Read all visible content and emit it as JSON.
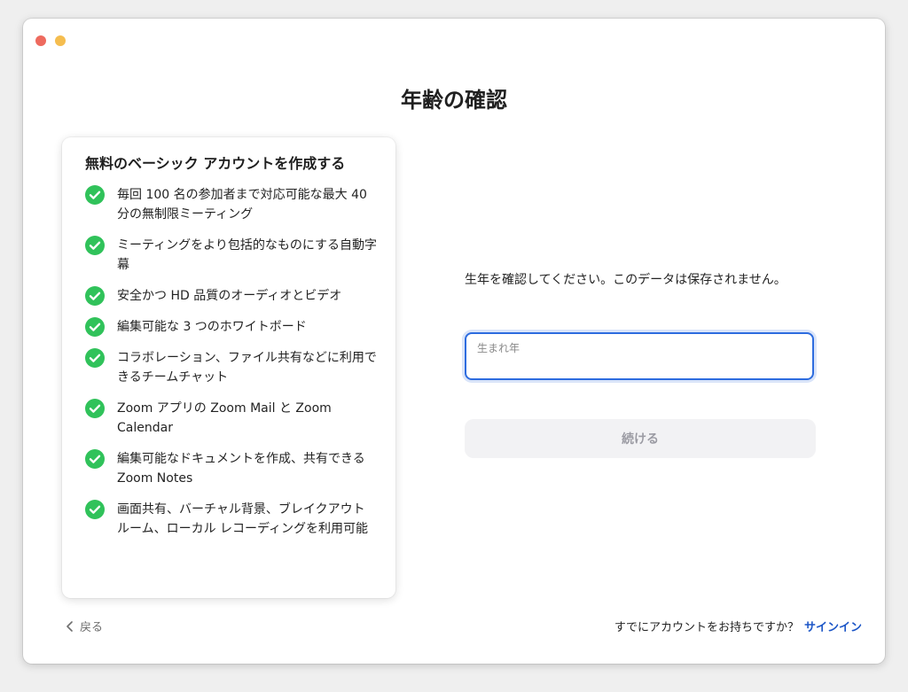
{
  "window": {
    "controls": [
      "close",
      "minimize"
    ]
  },
  "page": {
    "title": "年齢の確認"
  },
  "features": {
    "title": "無料のベーシック アカウントを作成する",
    "items": [
      {
        "label": "毎回 100 名の参加者まで対応可能な最大 40 分の無制限ミーティング"
      },
      {
        "label": "ミーティングをより包括的なものにする自動字幕"
      },
      {
        "label": "安全かつ HD 品質のオーディオとビデオ"
      },
      {
        "label": "編集可能な 3 つのホワイトボード"
      },
      {
        "label": "コラボレーション、ファイル共有などに利用できるチームチャット"
      },
      {
        "label": "Zoom アプリの Zoom Mail と Zoom Calendar"
      },
      {
        "label": "編集可能なドキュメントを作成、共有できる Zoom Notes"
      },
      {
        "label": "画面共有、バーチャル背景、ブレイクアウト ルーム、ローカル レコーディングを利用可能"
      }
    ],
    "icon": "check-circle-icon",
    "icon_color": "#30c25a"
  },
  "form": {
    "prompt": "生年を確認してください。このデータは保存されません。",
    "birth_year_label": "生まれ年",
    "birth_year_value": "",
    "continue_label": "続ける"
  },
  "footer": {
    "back_label": "戻る",
    "signin_prompt": "すでにアカウントをお持ちですか？",
    "signin_label": "サインイン"
  },
  "colors": {
    "accent": "#2d6cdf",
    "link": "#1c56c7",
    "check": "#30c25a"
  }
}
